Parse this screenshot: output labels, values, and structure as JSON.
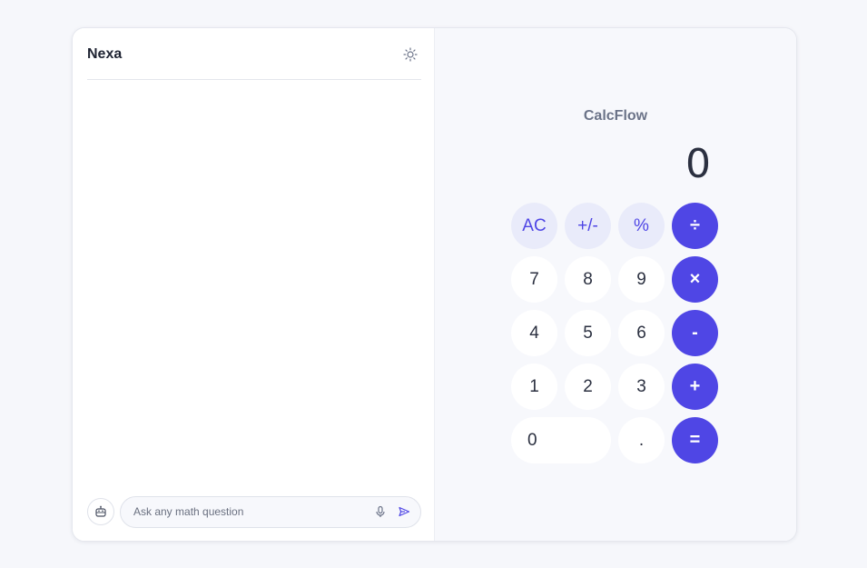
{
  "chat": {
    "title": "Nexa",
    "input_placeholder": "Ask any math question",
    "icons": {
      "theme": "sun-icon",
      "bot": "robot-icon",
      "mic": "microphone-icon",
      "send": "send-icon"
    }
  },
  "calculator": {
    "title": "CalcFlow",
    "display": "0",
    "keys": {
      "ac": "AC",
      "sign": "+/-",
      "percent": "%",
      "divide": "÷",
      "seven": "7",
      "eight": "8",
      "nine": "9",
      "multiply": "×",
      "four": "4",
      "five": "5",
      "six": "6",
      "minus": "-",
      "one": "1",
      "two": "2",
      "three": "3",
      "plus": "+",
      "zero": "0",
      "decimal": ".",
      "equals": "="
    }
  },
  "colors": {
    "accent": "#4f46e5",
    "function_key_bg": "#e9ebfa",
    "panel_bg": "#f7f8fc",
    "page_bg": "#f6f7fb"
  }
}
